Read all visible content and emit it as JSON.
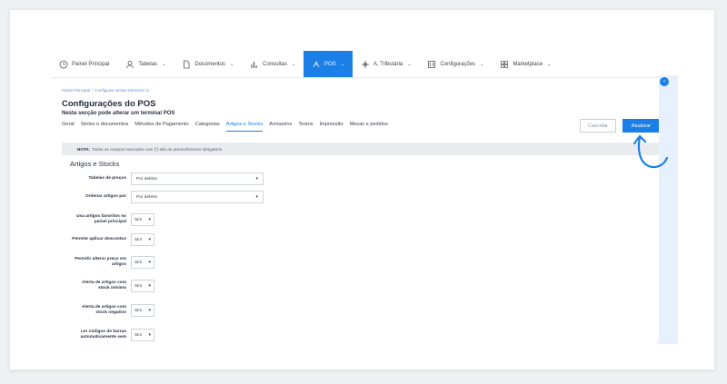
{
  "nav": {
    "items": [
      {
        "label": "Painel Principal",
        "icon": "clock-icon",
        "chevron": false
      },
      {
        "label": "Tabelas",
        "icon": "user-icon",
        "chevron": true
      },
      {
        "label": "Documentos",
        "icon": "document-icon",
        "chevron": true
      },
      {
        "label": "Consultas",
        "icon": "bar-chart-icon",
        "chevron": true
      },
      {
        "label": "POS",
        "icon": "pos-icon",
        "chevron": true,
        "active": true
      },
      {
        "label": "A. Tributária",
        "icon": "compass-icon",
        "chevron": true
      },
      {
        "label": "Configurações",
        "icon": "sliders-icon",
        "chevron": true
      },
      {
        "label": "Marketplace",
        "icon": "grid-icon",
        "chevron": true
      }
    ],
    "chevron_glyph": "⌄"
  },
  "breadcrumb": {
    "home": "Painel Principal",
    "separator": "/",
    "current": "Configurar mesas (terminal 1)"
  },
  "page": {
    "title": "Configurações do POS",
    "subtitle": "Nesta secção pode alterar um terminal POS"
  },
  "tabs": [
    {
      "label": "Geral"
    },
    {
      "label": "Séries e documentos"
    },
    {
      "label": "Métodos de Pagamento"
    },
    {
      "label": "Categorias"
    },
    {
      "label": "Artigos e Stocks",
      "active": true
    },
    {
      "label": "Armazéns"
    },
    {
      "label": "Textos"
    },
    {
      "label": "Impressão"
    },
    {
      "label": "Mesas e pedidos"
    }
  ],
  "actions": {
    "cancel": "Cancelar",
    "update": "Atualizar"
  },
  "note": {
    "label": "NOTA:",
    "text": "Todos os campos marcados com (*) são de preenchimento obrigatório"
  },
  "section": {
    "title": "Artigos e Stocks"
  },
  "fields": [
    {
      "label": "Tabelas de preços",
      "value": "Por defeito"
    },
    {
      "label": "Ordenar artigos por",
      "value": "Por defeito"
    },
    {
      "label": "Usa artigos favoritos no painel principal",
      "value": "Sim"
    },
    {
      "label": "Permite aplicar descontos",
      "value": "Sim"
    },
    {
      "label": "Permitir alterar preço em artigos",
      "value": "Sim"
    },
    {
      "label": "Alerta de artigos com stock mínimo",
      "value": "Sim"
    },
    {
      "label": "Alerta de artigos com stock negativo",
      "value": "Sim"
    },
    {
      "label": "Ler códigos de barras automaticamente sem",
      "value": "Sim"
    }
  ],
  "caret_glyph": "▾",
  "collapse_glyph": "‹",
  "colors": {
    "accent": "#1a7fe6",
    "sidebar_strip": "#e7f1fd",
    "note_bg": "#e9ebef"
  }
}
